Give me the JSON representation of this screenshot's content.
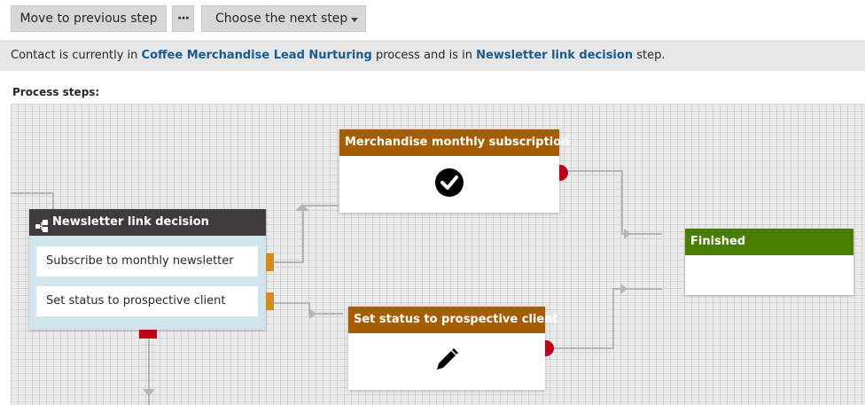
{
  "toolbar": {
    "previous_label": "Move to previous step",
    "more_label": "···",
    "next_label": "Choose the next step",
    "next_dropdown_icon": "triangle-down-icon"
  },
  "status": {
    "prefix": "Contact is currently in ",
    "process_name": "Coffee Merchandise Lead Nurturing",
    "middle": " process and is in ",
    "step_name": "Newsletter link decision",
    "suffix": " step."
  },
  "process": {
    "label": "Process steps:",
    "decision": {
      "title": "Newsletter link decision",
      "icon": "decision-icon",
      "cases": [
        "Subscribe to monthly newsletter",
        "Set status to prospective client"
      ]
    },
    "subscription": {
      "title": "Merchandise monthly subscription",
      "icon": "checkmark-icon"
    },
    "set_status": {
      "title": "Set status to prospective client",
      "icon": "pencil-icon"
    },
    "finished": {
      "title": "Finished"
    }
  },
  "colors": {
    "action_header": "#a65c00",
    "decision_header": "#403a3a",
    "finish_header": "#497d00",
    "link": "#1c5a8b",
    "port": "#d68a1c",
    "error_port": "#c0001a"
  }
}
